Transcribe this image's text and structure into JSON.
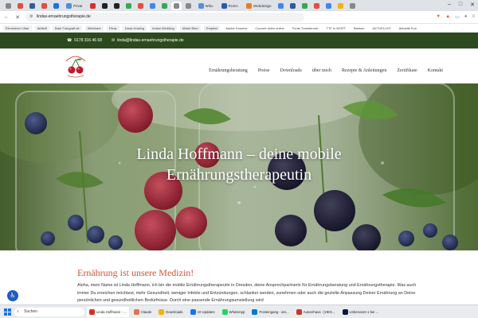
{
  "browser": {
    "tabs": [
      {
        "label": "",
        "color": "#888888"
      },
      {
        "label": "",
        "color": "#e74c3c"
      },
      {
        "label": "",
        "color": "#3b5998"
      },
      {
        "label": "",
        "color": "#e74c3c"
      },
      {
        "label": "",
        "color": "#1a73e8"
      },
      {
        "label": "Privat",
        "color": "#4a90d9"
      },
      {
        "label": "",
        "color": "#d93025"
      },
      {
        "label": "",
        "color": "#222222"
      },
      {
        "label": "",
        "color": "#222222"
      },
      {
        "label": "",
        "color": "#34a853"
      },
      {
        "label": "",
        "color": "#e74c3c"
      },
      {
        "label": "",
        "color": "#4285f4"
      },
      {
        "label": "",
        "color": "#34a853"
      },
      {
        "label": "",
        "color": "#888888",
        "active": true
      },
      {
        "label": "",
        "color": "#888888"
      },
      {
        "label": "Wiko",
        "color": "#5b8dd6"
      },
      {
        "label": "RUSA",
        "color": "#2b5aa8"
      },
      {
        "label": "Webdesign",
        "color": "#e67e22"
      },
      {
        "label": "",
        "color": "#4285f4"
      },
      {
        "label": "",
        "color": "#2b5aa8"
      },
      {
        "label": "",
        "color": "#34a853"
      },
      {
        "label": "",
        "color": "#e74c3c"
      },
      {
        "label": "",
        "color": "#4285f4"
      },
      {
        "label": "",
        "color": "#f4b400"
      },
      {
        "label": "",
        "color": "#888888"
      }
    ],
    "url": "lindas-ernaehrungstherapie.de",
    "bookmarks": [
      {
        "label": "Eliminieren Über",
        "chip": true
      },
      {
        "label": "AirBnB",
        "chip": true
      },
      {
        "label": "Bark Fotografi.de",
        "chip": true
      },
      {
        "label": "Webinare",
        "chip": true
      },
      {
        "label": "Fitcar",
        "chip": true
      },
      {
        "label": "Dana Hosting",
        "chip": true
      },
      {
        "label": "Indian Wedding",
        "chip": true
      },
      {
        "label": "Moike Bierr",
        "chip": true
      },
      {
        "label": "Emptiss",
        "chip": true
      },
      {
        "label": "Adobe Express",
        "chip": false
      },
      {
        "label": "Convert video online",
        "chip": false
      },
      {
        "label": "Fonts Transformer",
        "chip": false
      },
      {
        "label": "TTF in WOFF",
        "chip": false
      },
      {
        "label": "Banken",
        "chip": false
      },
      {
        "label": "AKTUELLES",
        "chip": false
      },
      {
        "label": "Aktuelle Kun",
        "chip": false
      }
    ]
  },
  "topbar": {
    "phone": "0178 316 46 68",
    "email": "linda@lindas-ernaehrungstherapie.de"
  },
  "nav": {
    "items": [
      "Ernährungsberatung",
      "Preise",
      "Downloads",
      "über mich",
      "Rezepte & Anleitungen",
      "Zertifikate",
      "Kontakt"
    ]
  },
  "hero": {
    "title_line1": "Linda Hoffmann – deine mobile",
    "title_line2": "Ernährungstherapeutin"
  },
  "content": {
    "heading": "Ernährung ist unsere Medizin!",
    "paragraph": "Aloha, mein Name ist Linda Hoffmann, ich bin die mobile  Ernährungstherapeutin in Dresden, deine Ansprechpartnerin für Ernährungsberatung und Ernährungstherapie. Was auch immer Du erreichen möchtest, mehr Gesundheit, weniger Infekte und Entzündungen, schlanker werden, zunehmen  oder auch die gezielte Anpassung Deiner Ernährung an Deine persönlichen und gesundheitlichen Bedürfnisse. Durch eine passende Ernährungsumstellung wird"
  },
  "taskbar": {
    "search_label": "Suchen",
    "apps": [
      {
        "label": "Linda Hoffmann - ...",
        "color": "#d93025",
        "active": true
      },
      {
        "label": "Claude",
        "color": "#d97757",
        "active": false
      },
      {
        "label": "Downloads",
        "color": "#f4b400",
        "active": false
      },
      {
        "label": "10 Updates",
        "color": "#1a73e8",
        "active": false
      },
      {
        "label": "WhatsApp",
        "color": "#25d366",
        "active": false
      },
      {
        "label": "Posteingang - am...",
        "color": "#0078d4",
        "active": false
      },
      {
        "label": "Autoerhaus - [HEG...",
        "color": "#c0392b",
        "active": false
      },
      {
        "label": "Unbenannt-1 bei ...",
        "color": "#001e36",
        "active": false
      }
    ]
  },
  "colors": {
    "topbar_bg": "#2c4a1e",
    "heading": "#c9563a",
    "a11y_button": "#1f5dbf"
  }
}
